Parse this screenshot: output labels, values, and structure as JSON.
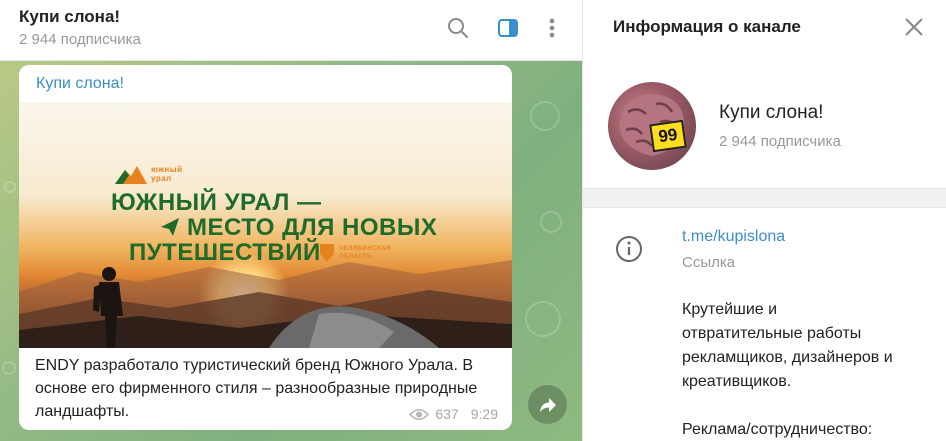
{
  "chat": {
    "title": "Купи слона!",
    "subscribers": "2 944 подписчика"
  },
  "post": {
    "author": "Купи слона!",
    "image": {
      "brand_small": "южный\nурал",
      "line1": "ЮЖНЫЙ УРАЛ —",
      "line2": "МЕСТО ДЛЯ НОВЫХ",
      "line3": "ПУТЕШЕСТВИЙ",
      "region": "ЧЕЛЯБИНСКАЯ\nОБЛАСТЬ"
    },
    "text": "ENDY разработало туристический бренд Южного Урала. В основе его фирменного стиля – разнообразные природные ландшафты.",
    "views": "637",
    "time": "9:29"
  },
  "info": {
    "title": "Информация о канале",
    "channel_name": "Купи слона!",
    "subscribers": "2 944 подписчика",
    "avatar_price": "99",
    "link": "t.me/kupislona",
    "link_label": "Ссылка",
    "description": "Крутейшие и\nотвратительные работы\nрекламщиков, дизайнеров и\nкреативщиков.\n\nРеклама/сотрудничество:"
  },
  "colors": {
    "accent": "#3a8fc8",
    "brand_green": "#1f6b2a",
    "brand_orange": "#e8821e"
  }
}
